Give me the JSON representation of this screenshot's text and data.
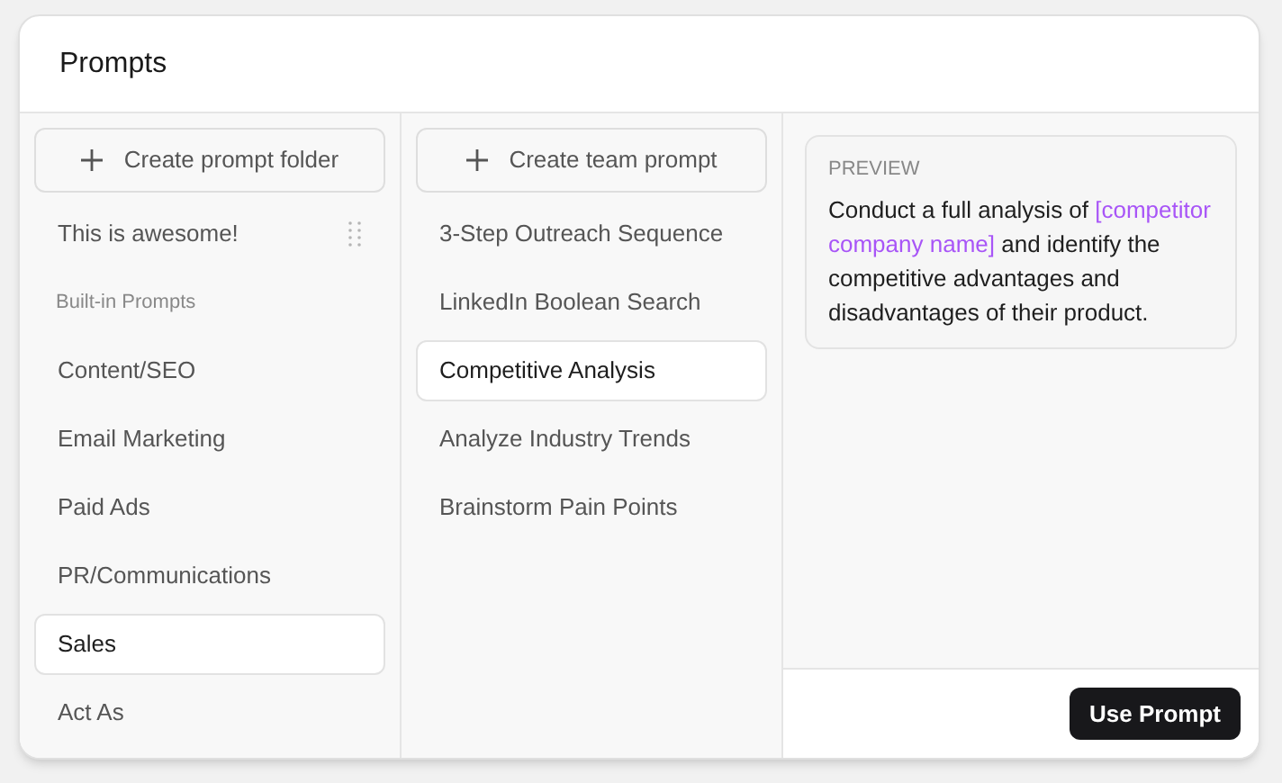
{
  "title": "Prompts",
  "folders": {
    "create_label": "Create prompt folder",
    "items": [
      {
        "kind": "folder",
        "label": "This is awesome!",
        "selected": false,
        "draggable": true
      },
      {
        "kind": "section",
        "label": "Built-in Prompts"
      },
      {
        "kind": "folder",
        "label": "Content/SEO",
        "selected": false
      },
      {
        "kind": "folder",
        "label": "Email Marketing",
        "selected": false
      },
      {
        "kind": "folder",
        "label": "Paid Ads",
        "selected": false
      },
      {
        "kind": "folder",
        "label": "PR/Communications",
        "selected": false
      },
      {
        "kind": "folder",
        "label": "Sales",
        "selected": true
      },
      {
        "kind": "folder",
        "label": "Act As",
        "selected": false
      }
    ]
  },
  "prompts": {
    "create_label": "Create team prompt",
    "items": [
      {
        "label": "3-Step Outreach Sequence",
        "selected": false
      },
      {
        "label": "LinkedIn Boolean Search",
        "selected": false
      },
      {
        "label": "Competitive Analysis",
        "selected": true
      },
      {
        "label": "Analyze Industry Trends",
        "selected": false
      },
      {
        "label": "Brainstorm Pain Points",
        "selected": false
      }
    ]
  },
  "preview": {
    "label": "PREVIEW",
    "segments": [
      {
        "kind": "text",
        "text": "Conduct a full analysis of "
      },
      {
        "kind": "variable",
        "text": "[competitor company name]"
      },
      {
        "kind": "text",
        "text": " and identify the competitive advantages and disadvantages of their product."
      }
    ]
  },
  "action_button": "Use Prompt"
}
